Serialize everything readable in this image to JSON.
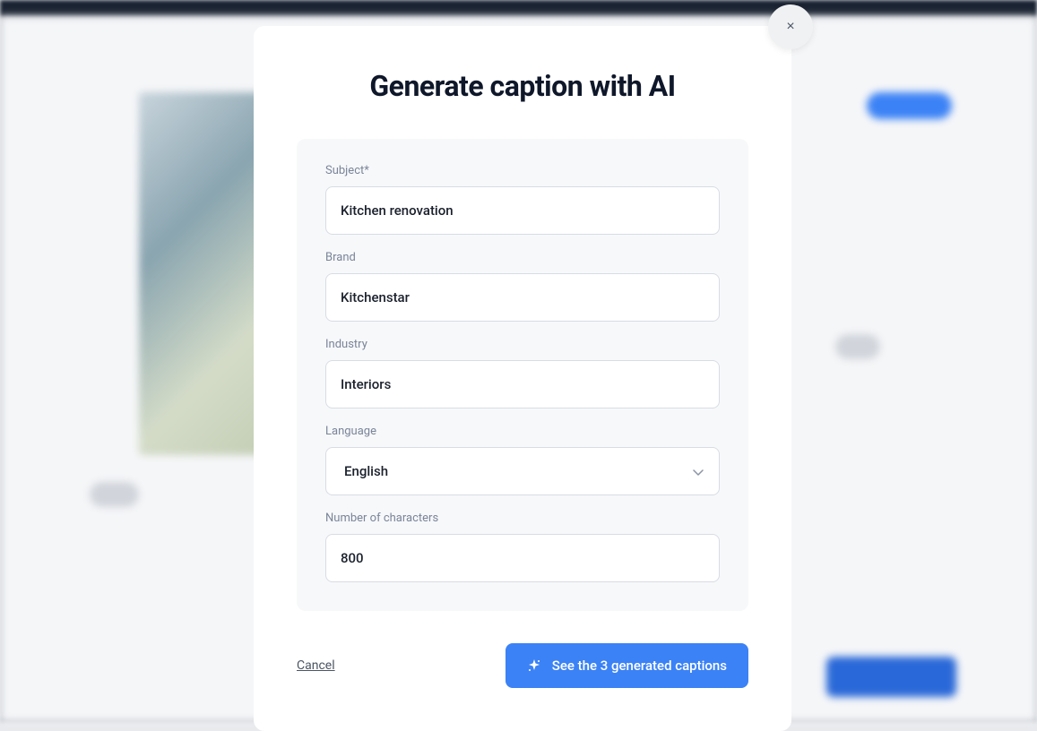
{
  "modal": {
    "title": "Generate caption with AI",
    "close_symbol": "×",
    "form": {
      "subject": {
        "label": "Subject",
        "required_mark": "*",
        "value": "Kitchen renovation"
      },
      "brand": {
        "label": "Brand",
        "value": "Kitchenstar"
      },
      "industry": {
        "label": "Industry",
        "value": "Interiors"
      },
      "language": {
        "label": "Language",
        "value": "English"
      },
      "char_count": {
        "label": "Number of characters",
        "value": "800"
      }
    },
    "footer": {
      "cancel_label": "Cancel",
      "generate_label": "See the 3 generated captions"
    }
  },
  "colors": {
    "primary": "#3b82f6",
    "text_dark": "#0f172a",
    "text_muted": "#7a8599",
    "border": "#d8dce3",
    "form_bg": "#f7f8fa"
  }
}
